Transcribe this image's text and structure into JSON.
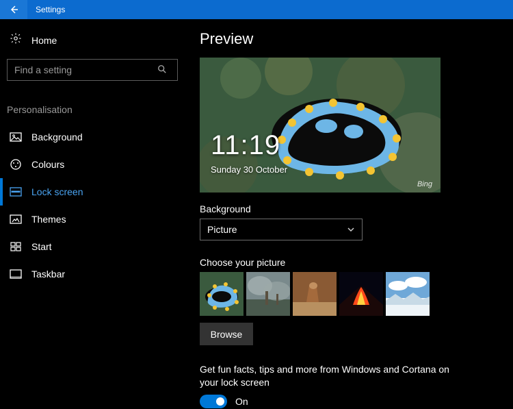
{
  "titlebar": {
    "label": "Settings"
  },
  "sidebar": {
    "home": "Home",
    "search_placeholder": "Find a setting",
    "category": "Personalisation",
    "items": [
      {
        "label": "Background"
      },
      {
        "label": "Colours"
      },
      {
        "label": "Lock screen"
      },
      {
        "label": "Themes"
      },
      {
        "label": "Start"
      },
      {
        "label": "Taskbar"
      }
    ]
  },
  "main": {
    "page_title": "Preview",
    "preview": {
      "time": "11:19",
      "date": "Sunday 30 October",
      "source": "Bing"
    },
    "background_label": "Background",
    "background_value": "Picture",
    "choose_label": "Choose your picture",
    "browse_label": "Browse",
    "fun_facts": "Get fun facts, tips and more from Windows and Cortana on your lock screen",
    "toggle_state": "On"
  }
}
